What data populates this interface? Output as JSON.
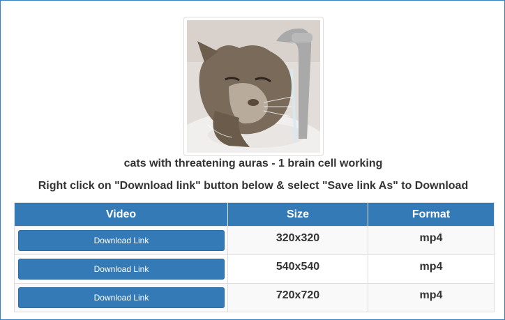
{
  "video": {
    "title": "cats with threatening auras - 1 brain cell working",
    "thumbnail_alt": "cat drinking from faucet"
  },
  "instructions": "Right click on \"Download link\" button below & select \"Save link As\" to Download",
  "table": {
    "headers": [
      "Video",
      "Size",
      "Format"
    ],
    "rows": [
      {
        "button": "Download Link",
        "size": "320x320",
        "format": "mp4"
      },
      {
        "button": "Download Link",
        "size": "540x540",
        "format": "mp4"
      },
      {
        "button": "Download Link",
        "size": "720x720",
        "format": "mp4"
      }
    ]
  },
  "colors": {
    "accent": "#337ab7",
    "border": "#3a82bf",
    "text": "#333333"
  }
}
